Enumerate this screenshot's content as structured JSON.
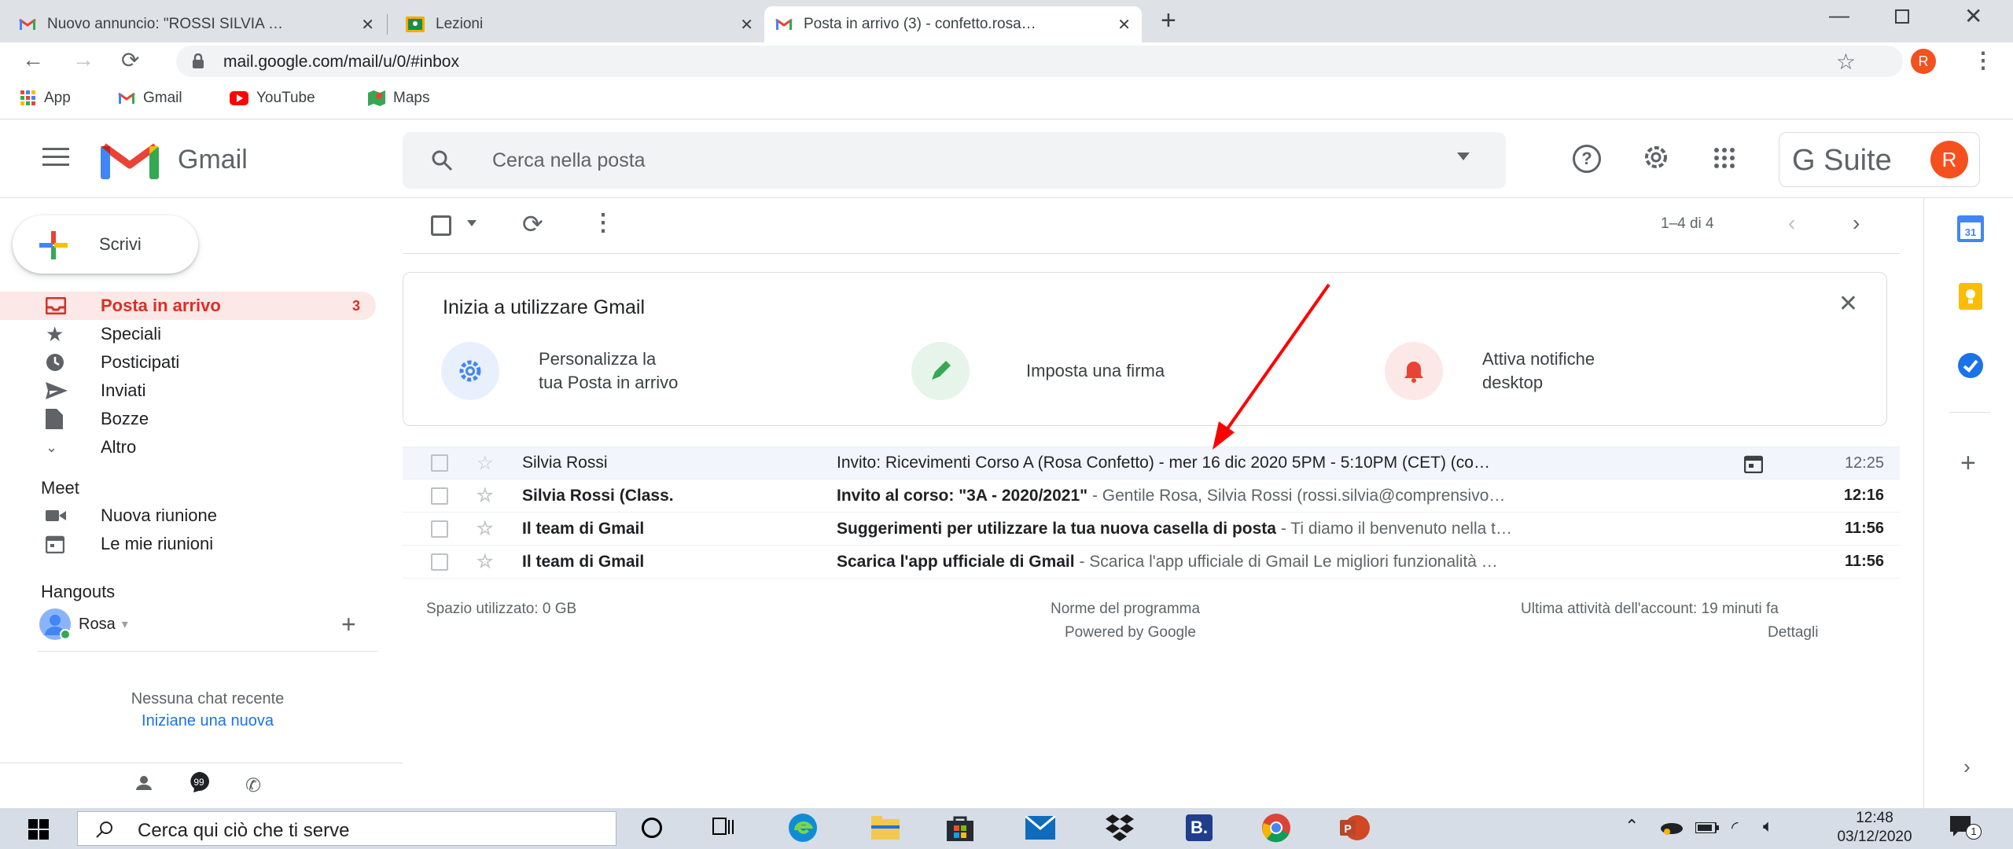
{
  "browser": {
    "tabs": [
      {
        "label": "Nuovo annuncio: \"ROSSI SILVIA …",
        "icon": "gmail-icon"
      },
      {
        "label": "Lezioni",
        "icon": "classroom-icon"
      },
      {
        "label": "Posta in arrivo (3) - confetto.rosa…",
        "icon": "gmail-icon"
      }
    ],
    "url": "mail.google.com/mail/u/0/#inbox",
    "profile_initial": "R",
    "bookmarks": [
      {
        "label": "App",
        "icon": "apps-grid-icon"
      },
      {
        "label": "Gmail",
        "icon": "gmail-icon"
      },
      {
        "label": "YouTube",
        "icon": "youtube-icon"
      },
      {
        "label": "Maps",
        "icon": "maps-icon"
      }
    ]
  },
  "gmail": {
    "logo_text": "Gmail",
    "search_placeholder": "Cerca nella posta",
    "gsuite_label": "G Suite",
    "avatar_initial": "R",
    "compose_label": "Scrivi",
    "nav": [
      {
        "label": "Posta in arrivo",
        "count": "3",
        "icon": "inbox-icon",
        "active": true
      },
      {
        "label": "Speciali",
        "count": "",
        "icon": "star-icon"
      },
      {
        "label": "Posticipati",
        "count": "",
        "icon": "clock-icon"
      },
      {
        "label": "Inviati",
        "count": "",
        "icon": "send-icon"
      },
      {
        "label": "Bozze",
        "count": "",
        "icon": "draft-icon"
      },
      {
        "label": "Altro",
        "count": "",
        "icon": "chevron-down-icon"
      }
    ],
    "meet": {
      "title": "Meet",
      "items": [
        {
          "label": "Nuova riunione",
          "icon": "video-icon"
        },
        {
          "label": "Le mie riunioni",
          "icon": "calendar-icon"
        }
      ]
    },
    "hangouts": {
      "title": "Hangouts",
      "user": "Rosa",
      "no_chat": "Nessuna chat recente",
      "start_new": "Iniziane una nuova"
    },
    "toolbar": {
      "pagination": "1–4 di 4"
    },
    "getting_started": {
      "title": "Inizia a utilizzare Gmail",
      "cards": [
        {
          "line1": "Personalizza la",
          "line2": "tua Posta in arrivo",
          "icon": "gear-icon",
          "color": "#4285f4",
          "bg": "#e8f0fe"
        },
        {
          "line1": "Imposta una firma",
          "line2": "",
          "icon": "pen-icon",
          "color": "#34a853",
          "bg": "#e6f4ea"
        },
        {
          "line1": "Attiva notifiche",
          "line2": "desktop",
          "icon": "bell-icon",
          "color": "#ea4335",
          "bg": "#fce8e6"
        }
      ]
    },
    "emails": [
      {
        "sender": "Silvia Rossi",
        "subject": "Invito: Ricevimenti Corso A (Rosa Confetto) - mer 16 dic 2020 5PM - 5:10PM (CET) (co…",
        "snippet": "",
        "time": "12:25",
        "unread": false,
        "has_calendar": true
      },
      {
        "sender": "Silvia Rossi (Class.",
        "subject": "Invito al corso: \"3A - 2020/2021\"",
        "snippet": " - Gentile Rosa, Silvia Rossi (rossi.silvia@comprensivo…",
        "time": "12:16",
        "unread": true,
        "has_calendar": false
      },
      {
        "sender": "Il team di Gmail",
        "subject": "Suggerimenti per utilizzare la tua nuova casella di posta",
        "snippet": " - Ti diamo il benvenuto nella t…",
        "time": "11:56",
        "unread": true,
        "has_calendar": false
      },
      {
        "sender": "Il team di Gmail",
        "subject": "Scarica l'app ufficiale di Gmail",
        "snippet": " - Scarica l'app ufficiale di Gmail Le migliori funzionalità …",
        "time": "11:56",
        "unread": true,
        "has_calendar": false
      }
    ],
    "footer": {
      "storage": "Spazio utilizzato: 0 GB",
      "policy": "Norme del programma",
      "powered": "Powered by Google",
      "activity": "Ultima attività dell'account: 19 minuti fa",
      "details": "Dettagli"
    }
  },
  "taskbar": {
    "search_placeholder": "Cerca qui ciò che ti serve",
    "time": "12:48",
    "date": "03/12/2020",
    "notification_count": "1"
  },
  "colors": {
    "gmail_red": "#d93025",
    "active_bg": "#fce8e6",
    "annotation_arrow": "#ff0000",
    "taskbar_bg": "#d6dde6"
  }
}
